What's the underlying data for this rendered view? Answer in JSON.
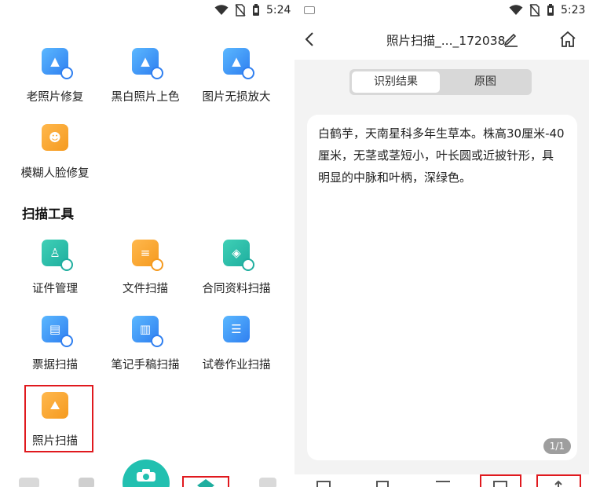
{
  "left": {
    "status_time": "5:24",
    "tools_top": [
      {
        "label": "老照片修复",
        "icon": "old-photo-repair-icon"
      },
      {
        "label": "黑白照片上色",
        "icon": "colorize-photo-icon"
      },
      {
        "label": "图片无损放大",
        "icon": "image-upscale-icon"
      },
      {
        "label": "模糊人脸修复",
        "icon": "face-restore-icon"
      }
    ],
    "section_title": "扫描工具",
    "tools_scan": [
      {
        "label": "证件管理",
        "icon": "id-card-icon"
      },
      {
        "label": "文件扫描",
        "icon": "file-scan-icon"
      },
      {
        "label": "合同资料扫描",
        "icon": "contract-scan-icon"
      },
      {
        "label": "票据扫描",
        "icon": "receipt-scan-icon"
      },
      {
        "label": "笔记手稿扫描",
        "icon": "notes-scan-icon"
      },
      {
        "label": "试卷作业扫描",
        "icon": "exam-scan-icon"
      },
      {
        "label": "照片扫描",
        "icon": "photo-scan-icon"
      }
    ]
  },
  "right": {
    "status_time": "5:23",
    "title": "照片扫描_..._172038",
    "tabs": [
      "识别结果",
      "原图"
    ],
    "active_tab": "识别结果",
    "result_text": "白鹤芋，天南星科多年生草本。株高30厘米-40厘米，无茎或茎短小，叶长圆或近披针形，具明显的中脉和叶柄，深绿色。",
    "page_indicator": "1/1"
  },
  "colors": {
    "highlight": "#e0191e",
    "blue": "#2f7ff0",
    "orange": "#f59a1f",
    "teal": "#1fae9f"
  }
}
